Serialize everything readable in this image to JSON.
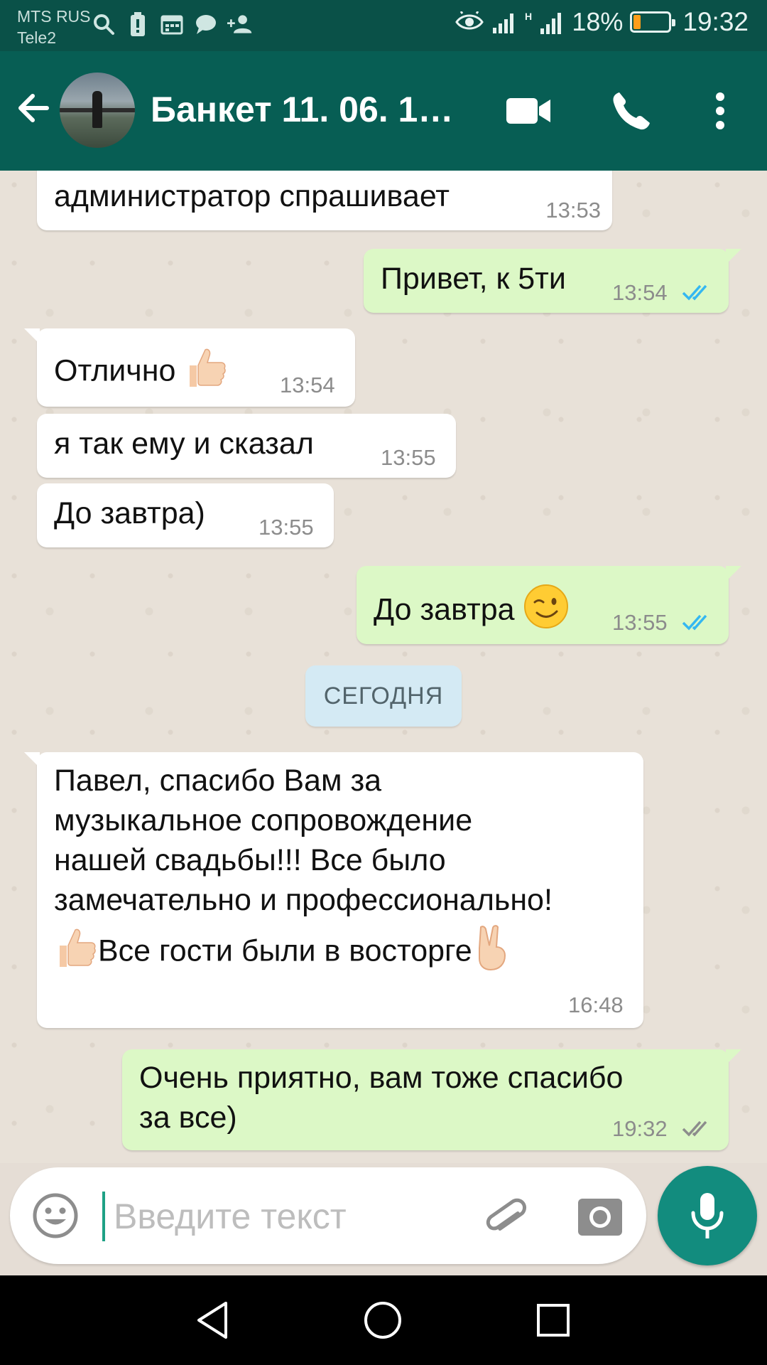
{
  "status_bar": {
    "carrier_1": "MTS RUS",
    "carrier_2": "Tele2",
    "signal_text": "Н",
    "battery_percent": "18%",
    "battery_level": 0.18,
    "time": "19:32",
    "icons": [
      "search-icon",
      "battery-saver-icon",
      "calendar-icon",
      "chat-icon",
      "add-contact-icon",
      "eye-icon",
      "signal-icon",
      "signal-h-icon"
    ]
  },
  "header": {
    "title": "Банкет 11. 06. 1…",
    "icons": [
      "back-arrow-icon",
      "video-call-icon",
      "phone-call-icon",
      "more-vert-icon"
    ]
  },
  "messages": [
    {
      "direction": "in",
      "text": "администратор спрашивает",
      "time": "13:53"
    },
    {
      "direction": "out",
      "text": "Привет, к 5ти",
      "time": "13:54",
      "status": "read"
    },
    {
      "direction": "in",
      "text": "Отлично",
      "emoji": "thumbs-up",
      "time": "13:54"
    },
    {
      "direction": "in",
      "text": "я так ему и сказал",
      "time": "13:55"
    },
    {
      "direction": "in",
      "text": "До завтра)",
      "time": "13:55"
    },
    {
      "direction": "out",
      "text": "До завтра",
      "emoji": "wink",
      "time": "13:55",
      "status": "read"
    },
    {
      "direction": "in",
      "lines": [
        "Павел, спасибо Вам за",
        "музыкальное сопровождение",
        "нашей свадьбы!!! Все было",
        "замечательно и профессионально!",
        "Все гости были в восторге"
      ],
      "time": "16:48"
    },
    {
      "direction": "out",
      "lines": [
        "Очень приятно, вам тоже спасибо",
        "за все)"
      ],
      "time": "19:32",
      "status": "delivered"
    }
  ],
  "date_divider": "СЕГОДНЯ",
  "composer": {
    "placeholder": "Введите текст",
    "icons": [
      "emoji-icon",
      "attach-icon",
      "camera-icon",
      "mic-icon"
    ]
  },
  "colors": {
    "status_bar": "#0a5148",
    "app_bar": "#075e54",
    "incoming_bubble": "#ffffff",
    "outgoing_bubble": "#dcf8c6",
    "read_ticks": "#34b7f1",
    "mic_button": "#128c7e"
  }
}
